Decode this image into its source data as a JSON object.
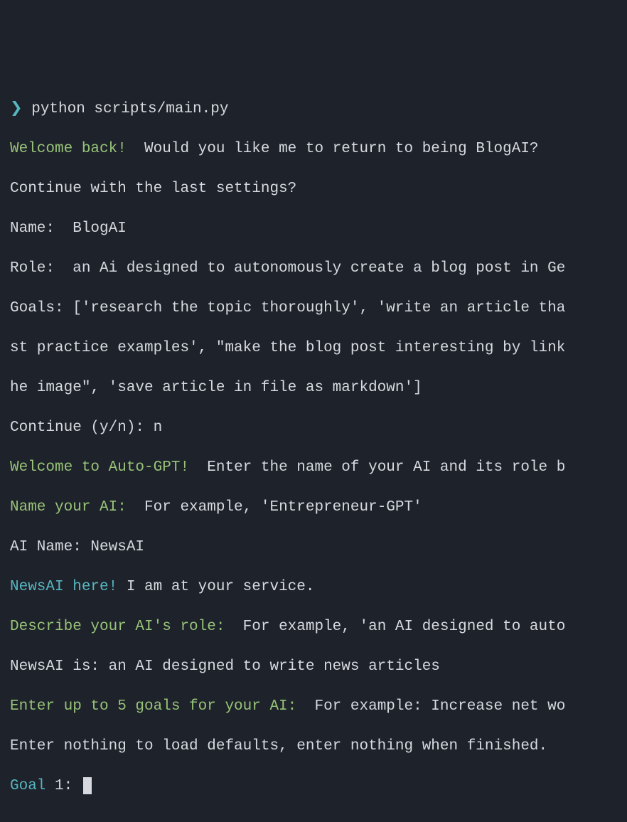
{
  "prompt": {
    "arrow": "❯",
    "cmd": "python scripts/main.py"
  },
  "l1a": "Welcome back! ",
  "l1b": " Would you like me to return to being BlogAI?",
  "l2": "Continue with the last settings?",
  "l3": "Name:  BlogAI",
  "l4": "Role:  an Ai designed to autonomously create a blog post in Ge",
  "l5": "Goals: ['research the topic thoroughly', 'write an article tha",
  "l6": "st practice examples', \"make the blog post interesting by link",
  "l7": "he image\", 'save article in file as markdown']",
  "l8": "Continue (y/n): n",
  "l9a": "Welcome to Auto-GPT! ",
  "l9b": " Enter the name of your AI and its role b",
  "l10a": "Name your AI: ",
  "l10b": " For example, 'Entrepreneur-GPT'",
  "l11": "AI Name: NewsAI",
  "l12a": "NewsAI here!",
  "l12b": " I am at your service.",
  "l13a": "Describe your AI's role: ",
  "l13b": " For example, 'an AI designed to auto",
  "l14": "NewsAI is: an AI designed to write news articles",
  "l15a": "Enter up to 5 goals for your AI: ",
  "l15b": " For example: Increase net wo",
  "l16": "Enter nothing to load defaults, enter nothing when finished.",
  "l17a": "Goal",
  "l17b": " 1: "
}
